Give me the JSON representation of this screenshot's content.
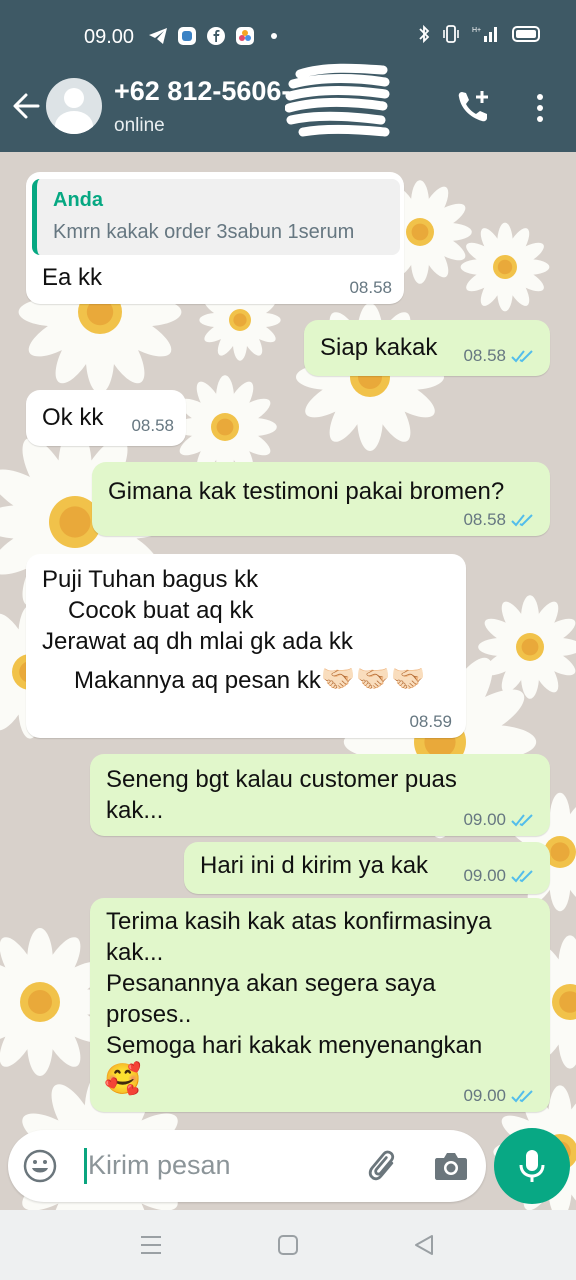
{
  "status_bar": {
    "time": "09.00"
  },
  "header": {
    "contact_name": "+62 812-5606-",
    "contact_status": "online"
  },
  "messages": [
    {
      "direction": "in",
      "quote": {
        "author": "Anda",
        "text": "Kmrn kakak order 3sabun 1serum"
      },
      "text": "Ea kk",
      "time": "08.58"
    },
    {
      "direction": "out",
      "text": "Siap kakak",
      "time": "08.58",
      "read": true
    },
    {
      "direction": "in",
      "text": "Ok kk",
      "time": "08.58"
    },
    {
      "direction": "out",
      "text": "Gimana kak testimoni pakai bromen?",
      "time": "08.58",
      "read": true
    },
    {
      "direction": "in",
      "lines": [
        "Puji Tuhan bagus kk",
        "Cocok buat aq kk",
        "Jerawat aq dh mlai gk ada kk",
        "Makannya aq pesan kk"
      ],
      "emoji": "🤝🏻🤝🏻🤝🏻",
      "time": "08.59"
    },
    {
      "direction": "out",
      "lines": [
        "Seneng bgt kalau customer puas",
        "kak..."
      ],
      "time": "09.00",
      "read": true
    },
    {
      "direction": "out",
      "text": "Hari ini d kirim ya kak",
      "time": "09.00",
      "read": true
    },
    {
      "direction": "out",
      "lines": [
        "Terima kasih kak atas konfirmasinya",
        "kak...",
        "Pesanannya akan segera saya",
        "proses..",
        "Semoga hari kakak menyenangkan"
      ],
      "emoji": "🥰",
      "time": "09.00",
      "read": true
    }
  ],
  "composer": {
    "placeholder": "Kirim pesan"
  },
  "colors": {
    "header": "#3e5965",
    "outgoing_bubble": "#e1f7cb",
    "incoming_bubble": "#ffffff",
    "accent": "#08a884",
    "read_ticks": "#53bdeb"
  }
}
